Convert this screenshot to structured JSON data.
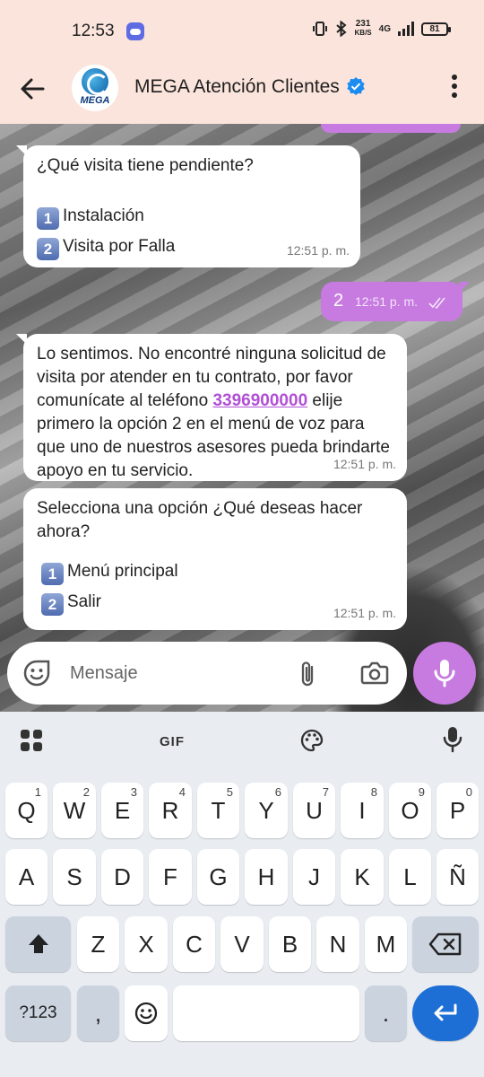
{
  "status_bar": {
    "time": "12:53",
    "speed_value": "231",
    "speed_unit": "KB/S",
    "network": "4G",
    "battery": "81"
  },
  "header": {
    "contact_name": "MEGA Atención Clientes",
    "avatar_text": "MEGA",
    "verified_icon": "verified-badge-icon"
  },
  "chat": {
    "messages": [
      {
        "direction": "incoming",
        "text": "¿Qué visita tiene pendiente?",
        "options": [
          {
            "number": "1",
            "label": "Instalación"
          },
          {
            "number": "2",
            "label": "Visita por Falla"
          }
        ],
        "time": "12:51 p. m."
      },
      {
        "direction": "outgoing",
        "text": "2",
        "time": "12:51 p. m.",
        "status": "read"
      },
      {
        "direction": "incoming",
        "text_before": "Lo sentimos. No encontré ninguna solicitud de visita por atender en tu contrato, por favor comunícate al teléfono",
        "phone": "3396900000",
        "text_after": "elije primero la opción 2 en el menú de voz para que uno de nuestros asesores pueda brindarte apoyo en tu servicio.",
        "time": "12:51 p. m."
      },
      {
        "direction": "incoming",
        "text": "Selecciona una opción ¿Qué deseas hacer ahora?",
        "options": [
          {
            "number": "1",
            "label": "Menú principal"
          },
          {
            "number": "2",
            "label": "Salir"
          }
        ],
        "time": "12:51 p. m."
      }
    ]
  },
  "composer": {
    "placeholder": "Mensaje"
  },
  "keyboard": {
    "toolbar_gif": "GIF",
    "row1": [
      {
        "key": "Q",
        "sup": "1"
      },
      {
        "key": "W",
        "sup": "2"
      },
      {
        "key": "E",
        "sup": "3"
      },
      {
        "key": "R",
        "sup": "4"
      },
      {
        "key": "T",
        "sup": "5"
      },
      {
        "key": "Y",
        "sup": "6"
      },
      {
        "key": "U",
        "sup": "7"
      },
      {
        "key": "I",
        "sup": "8"
      },
      {
        "key": "O",
        "sup": "9"
      },
      {
        "key": "P",
        "sup": "0"
      }
    ],
    "row2": [
      "A",
      "S",
      "D",
      "F",
      "G",
      "H",
      "J",
      "K",
      "L",
      "Ñ"
    ],
    "row3": [
      "Z",
      "X",
      "C",
      "V",
      "B",
      "N",
      "M"
    ],
    "symbols_key": "?123",
    "comma_key": ",",
    "period_key": "."
  },
  "colors": {
    "accent": "#c77be0",
    "header_bg": "#fbe4dc",
    "link": "#b050d6",
    "enter_key": "#1d6fd6"
  }
}
